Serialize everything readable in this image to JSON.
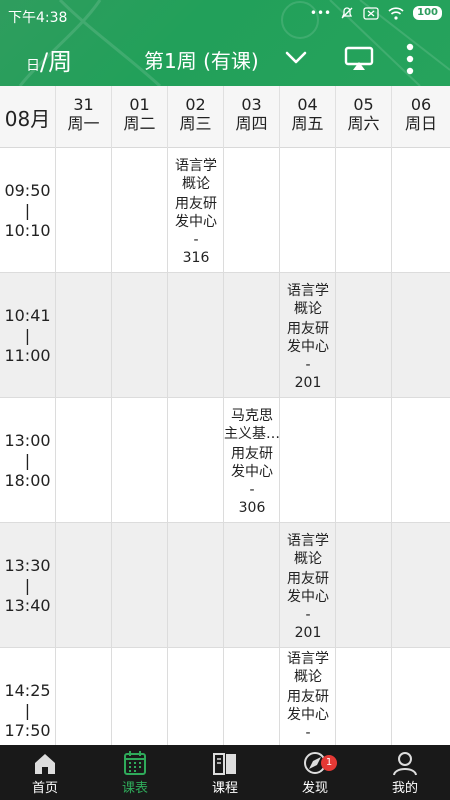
{
  "status_bar": {
    "time": "下午4:38",
    "battery": "100"
  },
  "appbar": {
    "view_toggle_small": "日",
    "view_toggle_main": "/周",
    "week_title": "第1周 (有课)"
  },
  "header": {
    "month": "08月",
    "days": [
      {
        "date": "31",
        "weekday": "周一"
      },
      {
        "date": "01",
        "weekday": "周二"
      },
      {
        "date": "02",
        "weekday": "周三"
      },
      {
        "date": "03",
        "weekday": "周四"
      },
      {
        "date": "04",
        "weekday": "周五"
      },
      {
        "date": "05",
        "weekday": "周六"
      },
      {
        "date": "06",
        "weekday": "周日"
      }
    ]
  },
  "time_slots": [
    {
      "start": "09:50",
      "sep": "|",
      "end": "10:10"
    },
    {
      "start": "10:41",
      "sep": "|",
      "end": "11:00"
    },
    {
      "start": "13:00",
      "sep": "|",
      "end": "18:00"
    },
    {
      "start": "13:30",
      "sep": "|",
      "end": "13:40"
    },
    {
      "start": "14:25",
      "sep": "|",
      "end": "17:50"
    }
  ],
  "courses": [
    {
      "name_line1": "语言学",
      "name_line2": "概论",
      "loc_line1": "用友研",
      "loc_line2": "发中心",
      "sep": "-",
      "room": "316"
    },
    {
      "name_line1": "语言学",
      "name_line2": "概论",
      "loc_line1": "用友研",
      "loc_line2": "发中心",
      "sep": "-",
      "room": "201"
    },
    {
      "name_line1": "马克思",
      "name_line2": "主义基…",
      "loc_line1": "用友研",
      "loc_line2": "发中心",
      "sep": "-",
      "room": "306"
    },
    {
      "name_line1": "语言学",
      "name_line2": "概论",
      "loc_line1": "用友研",
      "loc_line2": "发中心",
      "sep": "-",
      "room": "201"
    },
    {
      "name_line1": "语言学",
      "name_line2": "概论",
      "loc_line1": "用友研",
      "loc_line2": "发中心",
      "sep": "-",
      "room": ""
    }
  ],
  "bottom_nav": {
    "items": [
      {
        "label": "首页",
        "icon": "home-icon"
      },
      {
        "label": "课表",
        "icon": "timetable-icon"
      },
      {
        "label": "课程",
        "icon": "book-icon"
      },
      {
        "label": "发现",
        "icon": "discover-icon",
        "badge": "1"
      },
      {
        "label": "我的",
        "icon": "profile-icon"
      }
    ],
    "active_index": 1,
    "active_color": "#2faa5a"
  },
  "colors": {
    "primary_green": "#2a9f5c",
    "alt_row": "#efefef",
    "nav_bg": "#191919",
    "badge": "#e53935"
  }
}
